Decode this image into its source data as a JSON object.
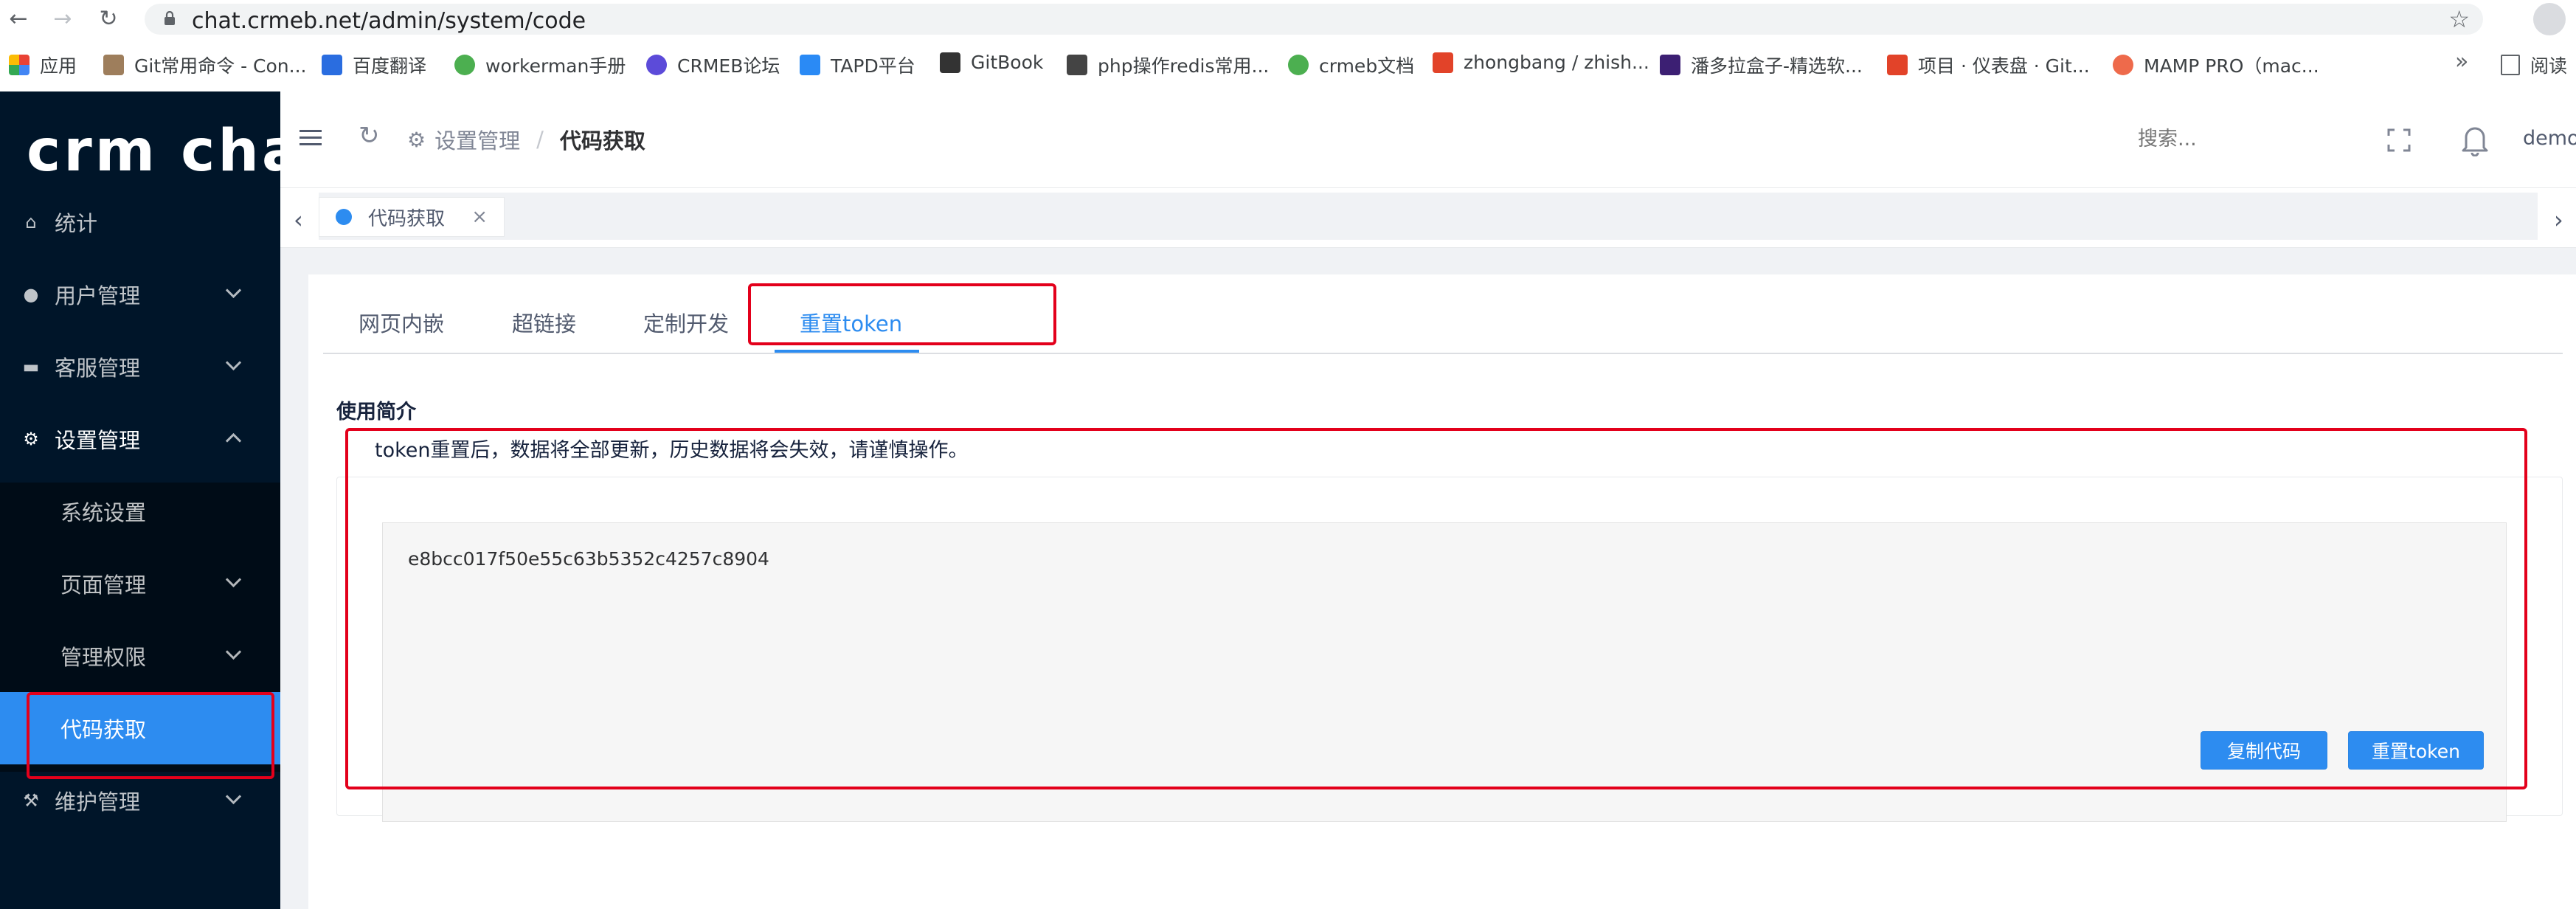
{
  "browser": {
    "url": "chat.crmeb.net/admin/system/code",
    "bookmarks": [
      {
        "label": "应用",
        "color": "#e94235"
      },
      {
        "label": "Git常用命令 - Con...",
        "color": "#9e7e5c"
      },
      {
        "label": "百度翻译",
        "color": "#2a6de0"
      },
      {
        "label": "workerman手册",
        "color": "#4caf50"
      },
      {
        "label": "CRMEB论坛",
        "color": "#5c4bd9"
      },
      {
        "label": "TAPD平台",
        "color": "#2a8af5"
      },
      {
        "label": "GitBook",
        "color": "#333333"
      },
      {
        "label": "php操作redis常用...",
        "color": "#444444"
      },
      {
        "label": "crmeb文档",
        "color": "#4caf50"
      },
      {
        "label": "zhongbang / zhish...",
        "color": "#e24329"
      },
      {
        "label": "潘多拉盒子-精选软...",
        "color": "#3c1f73"
      },
      {
        "label": "项目 · 仪表盘 · Git...",
        "color": "#e24329"
      },
      {
        "label": "MAMP PRO（mac...",
        "color": "#ee6a4b"
      }
    ],
    "more_label": "»",
    "reading_label": "阅读"
  },
  "sidebar": {
    "logo": "crm chat",
    "items": [
      {
        "label": "统计",
        "icon": "home-icon"
      },
      {
        "label": "用户管理",
        "icon": "user-icon"
      },
      {
        "label": "客服管理",
        "icon": "chat-icon"
      },
      {
        "label": "设置管理",
        "icon": "gear-icon"
      },
      {
        "label": "维护管理",
        "icon": "wrench-icon"
      }
    ],
    "submenu": [
      {
        "label": "系统设置"
      },
      {
        "label": "页面管理"
      },
      {
        "label": "管理权限"
      },
      {
        "label": "代码获取"
      }
    ]
  },
  "header": {
    "breadcrumb_parent": "设置管理",
    "breadcrumb_sep": "/",
    "breadcrumb_current": "代码获取",
    "search_placeholder": "搜索...",
    "user": "demo"
  },
  "tagbar": {
    "tag_label": "代码获取",
    "close": "×"
  },
  "content": {
    "tabs": [
      "网页内嵌",
      "超链接",
      "定制开发",
      "重置token"
    ],
    "active_tab": 3,
    "section_title": "使用简介",
    "description": "token重置后，数据将全部更新，历史数据将会失效，请谨慎操作。",
    "token": "e8bcc017f50e55c63b5352c4257c8904",
    "copy_button": "复制代码",
    "reset_button": "重置token"
  },
  "colors": {
    "sidebar_bg": "#001529",
    "accent": "#2d8cf0",
    "annotation": "#e3001b"
  }
}
